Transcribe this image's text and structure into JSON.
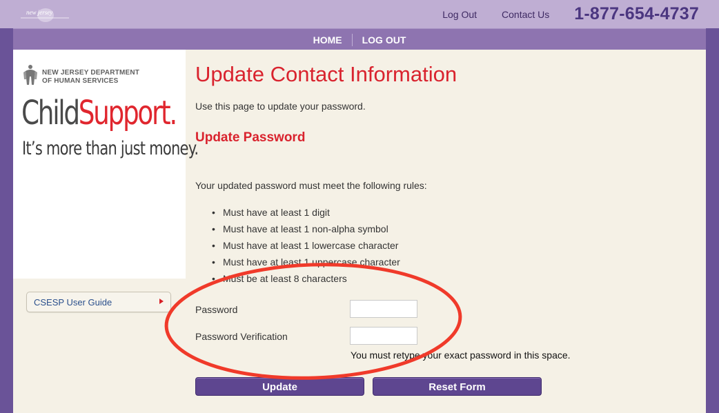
{
  "header": {
    "state_logo_text": "new jersey",
    "links": {
      "logout": "Log Out",
      "contact": "Contact Us"
    },
    "phone": "1-877-654-4737"
  },
  "nav": {
    "home": "HOME",
    "logout": "LOG OUT"
  },
  "sidebar": {
    "dept_line1": "NEW JERSEY DEPARTMENT",
    "dept_line2": "OF HUMAN SERVICES",
    "brand_child": "Child",
    "brand_support": "Support.",
    "tagline": "It’s more than just money.",
    "guide_label": "CSESP User Guide"
  },
  "main": {
    "title": "Update Contact Information",
    "intro": "Use this page to update your password.",
    "section_title": "Update Password",
    "rules_intro": "Your updated password must meet the following rules:",
    "rules": [
      "Must have at least 1 digit",
      "Must have at least 1 non-alpha symbol",
      "Must have at least 1 lowercase character",
      "Must have at least 1 uppercase character",
      "Must be at least 8 characters"
    ],
    "form": {
      "password_label": "Password",
      "password_value": "",
      "verification_label": "Password Verification",
      "verification_value": "",
      "hint": "You must retype your exact password in this space."
    },
    "buttons": {
      "update": "Update",
      "reset": "Reset Form"
    }
  },
  "colors": {
    "brand_purple": "#5e4690",
    "title_red": "#d9232e",
    "annotation_red": "#f03a2a"
  }
}
